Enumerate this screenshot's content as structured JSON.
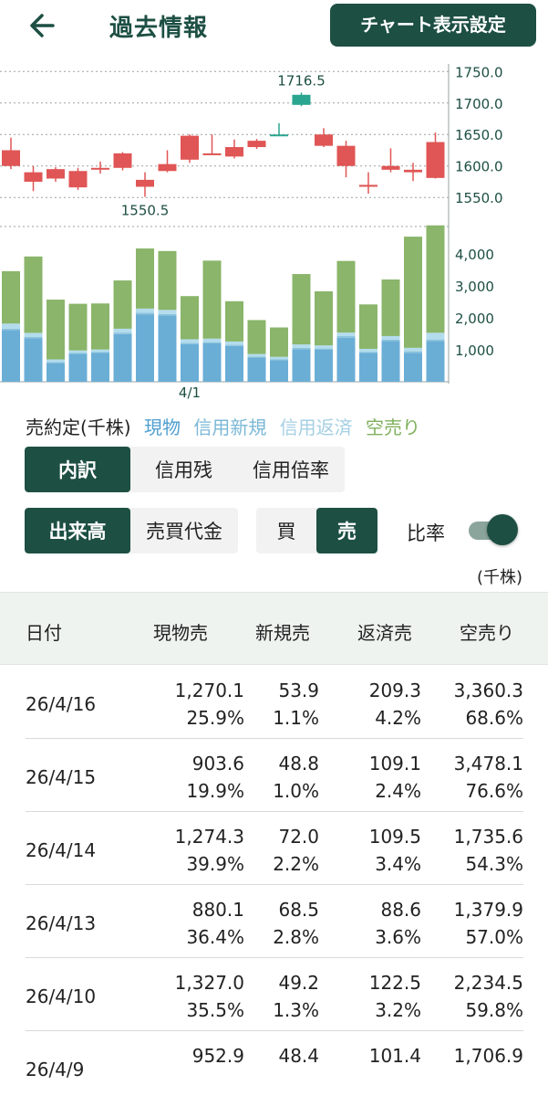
{
  "header": {
    "title": "過去情報",
    "chart_settings_label": "チャート表示設定",
    "back_icon": "arrow-left-icon"
  },
  "colors": {
    "primary": "#1d4f43",
    "up": "#2aa58f",
    "down": "#e05555",
    "genbutsu": "#6aaed6",
    "shinyo_shinki": "#8bc3dc",
    "shinyo_hensai": "#b3dced",
    "karauri": "#8ab56a"
  },
  "chart_data": {
    "type": "candlestick+stacked-bar",
    "price_axis": {
      "ticks": [
        "1750.0",
        "1700.0",
        "1650.0",
        "1600.0",
        "1550.0"
      ],
      "range": [
        1530,
        1762
      ]
    },
    "price_annotations": [
      {
        "label": "1716.5",
        "index": 13
      },
      {
        "label": "1550.5",
        "index": 6
      }
    ],
    "candles": [
      {
        "o": 1625,
        "c": 1600,
        "h": 1645,
        "l": 1595
      },
      {
        "o": 1590,
        "c": 1575,
        "h": 1600,
        "l": 1560
      },
      {
        "o": 1595,
        "c": 1580,
        "h": 1598,
        "l": 1575
      },
      {
        "o": 1592,
        "c": 1566,
        "h": 1597,
        "l": 1562
      },
      {
        "o": 1597,
        "c": 1595,
        "h": 1607,
        "l": 1588
      },
      {
        "o": 1620,
        "c": 1597,
        "h": 1622,
        "l": 1593
      },
      {
        "o": 1578,
        "c": 1567,
        "h": 1590,
        "l": 1551
      },
      {
        "o": 1603,
        "c": 1592,
        "h": 1625,
        "l": 1590
      },
      {
        "o": 1648,
        "c": 1610,
        "h": 1650,
        "l": 1605
      },
      {
        "o": 1620,
        "c": 1619,
        "h": 1650,
        "l": 1619
      },
      {
        "o": 1630,
        "c": 1615,
        "h": 1642,
        "l": 1612
      },
      {
        "o": 1640,
        "c": 1630,
        "h": 1643,
        "l": 1627
      },
      {
        "o": 1650,
        "c": 1650,
        "h": 1668,
        "l": 1650
      },
      {
        "o": 1697,
        "c": 1713,
        "h": 1716.5,
        "l": 1695
      },
      {
        "o": 1650,
        "c": 1632,
        "h": 1660,
        "l": 1630
      },
      {
        "o": 1632,
        "c": 1600,
        "h": 1640,
        "l": 1582
      },
      {
        "o": 1570,
        "c": 1567,
        "h": 1590,
        "l": 1556
      },
      {
        "o": 1600,
        "c": 1594,
        "h": 1628,
        "l": 1590
      },
      {
        "o": 1594,
        "c": 1590,
        "h": 1605,
        "l": 1576
      },
      {
        "o": 1638,
        "c": 1581,
        "h": 1653,
        "l": 1580
      }
    ],
    "volume_axis": {
      "ticks": [
        "4,000",
        "3,000",
        "2,000",
        "1,000"
      ],
      "max": 4800
    },
    "x_label": "4/1",
    "x_label_index": 8,
    "volumes": [
      {
        "g": 1620,
        "s": 40,
        "h": 160,
        "k": 1640
      },
      {
        "g": 1360,
        "s": 40,
        "h": 130,
        "k": 2390
      },
      {
        "g": 590,
        "s": 30,
        "h": 80,
        "k": 1870
      },
      {
        "g": 870,
        "s": 30,
        "h": 80,
        "k": 1460
      },
      {
        "g": 900,
        "s": 30,
        "h": 80,
        "k": 1440
      },
      {
        "g": 1490,
        "s": 50,
        "h": 120,
        "k": 1510
      },
      {
        "g": 2110,
        "s": 50,
        "h": 130,
        "k": 1880
      },
      {
        "g": 2070,
        "s": 50,
        "h": 130,
        "k": 1840
      },
      {
        "g": 1180,
        "s": 40,
        "h": 110,
        "k": 1350
      },
      {
        "g": 1200,
        "s": 40,
        "h": 110,
        "k": 2440
      },
      {
        "g": 1120,
        "s": 40,
        "h": 100,
        "k": 1260
      },
      {
        "g": 760,
        "s": 30,
        "h": 80,
        "k": 1060
      },
      {
        "g": 680,
        "s": 30,
        "h": 70,
        "k": 920
      },
      {
        "g": 1020,
        "s": 40,
        "h": 110,
        "k": 2200
      },
      {
        "g": 1000,
        "s": 40,
        "h": 100,
        "k": 1690
      },
      {
        "g": 1380,
        "s": 50,
        "h": 110,
        "k": 2240
      },
      {
        "g": 900,
        "s": 30,
        "h": 100,
        "k": 1390
      },
      {
        "g": 1270,
        "s": 50,
        "h": 110,
        "k": 1770
      },
      {
        "g": 904,
        "s": 49,
        "h": 109,
        "k": 3478
      },
      {
        "g": 1270,
        "s": 54,
        "h": 209,
        "k": 3360
      }
    ]
  },
  "legend": {
    "title": "売約定(千株)",
    "genbutsu": "現物",
    "shinyo_shinki": "信用新規",
    "shinyo_hensai": "信用返済",
    "karauri": "空売り"
  },
  "tabs": [
    "内訳",
    "信用残",
    "信用倍率"
  ],
  "volume_toggle": [
    "出来高",
    "売買代金"
  ],
  "side_toggle": [
    "買",
    "売"
  ],
  "ratio_label": "比率",
  "unit_label": "(千株)",
  "table": {
    "headers": [
      "日付",
      "現物売",
      "新規売",
      "返済売",
      "空売り"
    ],
    "rows": [
      {
        "date": "26/4/16",
        "c1": "1,270.1",
        "c1p": "25.9%",
        "c2": "53.9",
        "c2p": "1.1%",
        "c3": "209.3",
        "c3p": "4.2%",
        "c4": "3,360.3",
        "c4p": "68.6%"
      },
      {
        "date": "26/4/15",
        "c1": "903.6",
        "c1p": "19.9%",
        "c2": "48.8",
        "c2p": "1.0%",
        "c3": "109.1",
        "c3p": "2.4%",
        "c4": "3,478.1",
        "c4p": "76.6%"
      },
      {
        "date": "26/4/14",
        "c1": "1,274.3",
        "c1p": "39.9%",
        "c2": "72.0",
        "c2p": "2.2%",
        "c3": "109.5",
        "c3p": "3.4%",
        "c4": "1,735.6",
        "c4p": "54.3%"
      },
      {
        "date": "26/4/13",
        "c1": "880.1",
        "c1p": "36.4%",
        "c2": "68.5",
        "c2p": "2.8%",
        "c3": "88.6",
        "c3p": "3.6%",
        "c4": "1,379.9",
        "c4p": "57.0%"
      },
      {
        "date": "26/4/10",
        "c1": "1,327.0",
        "c1p": "35.5%",
        "c2": "49.2",
        "c2p": "1.3%",
        "c3": "122.5",
        "c3p": "3.2%",
        "c4": "2,234.5",
        "c4p": "59.8%"
      },
      {
        "date": "26/4/9",
        "c1": "952.9",
        "c1p": "",
        "c2": "48.4",
        "c2p": "",
        "c3": "101.4",
        "c3p": "",
        "c4": "1,706.9",
        "c4p": ""
      }
    ]
  }
}
